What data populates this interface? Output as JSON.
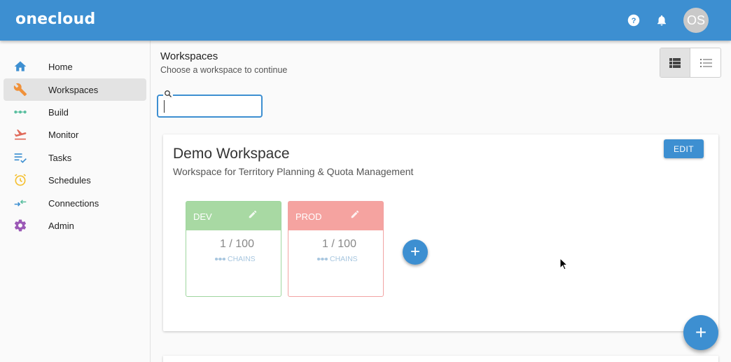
{
  "header": {
    "logo": "onecloud",
    "avatar_initials": "OS",
    "help_icon": "help-circle-icon",
    "bell_icon": "bell-icon"
  },
  "sidebar": {
    "items": [
      {
        "label": "Home",
        "icon": "home-icon",
        "color": "#3d8fd1",
        "active": false
      },
      {
        "label": "Workspaces",
        "icon": "wrench-icon",
        "color": "#f0913a",
        "active": true
      },
      {
        "label": "Build",
        "icon": "chain-icon",
        "color": "#5bbfa0",
        "active": false
      },
      {
        "label": "Monitor",
        "icon": "plane-icon",
        "color": "#e06a5a",
        "active": false
      },
      {
        "label": "Tasks",
        "icon": "tasks-icon",
        "color": "#3d8fd1",
        "active": false
      },
      {
        "label": "Schedules",
        "icon": "clock-icon",
        "color": "#f5c031",
        "active": false
      },
      {
        "label": "Connections",
        "icon": "connections-icon",
        "color": "#3d8fd1",
        "active": false
      },
      {
        "label": "Admin",
        "icon": "gear-icon",
        "color": "#9b59b6",
        "active": false
      }
    ]
  },
  "page": {
    "title": "Workspaces",
    "subtitle": "Choose a workspace to continue"
  },
  "search": {
    "value": "",
    "placeholder": ""
  },
  "workspace": {
    "title": "Demo Workspace",
    "description": "Workspace for Territory Planning & Quota Management",
    "edit_label": "EDIT",
    "environments": [
      {
        "name": "DEV",
        "count": "1 / 100",
        "chains_label": "CHAINS",
        "color": "#a8d9a3"
      },
      {
        "name": "PROD",
        "count": "1 / 100",
        "chains_label": "CHAINS",
        "color": "#f5a3a0"
      }
    ],
    "add_env_label": "+"
  },
  "fab_label": "+",
  "colors": {
    "primary": "#3d8fd1"
  }
}
